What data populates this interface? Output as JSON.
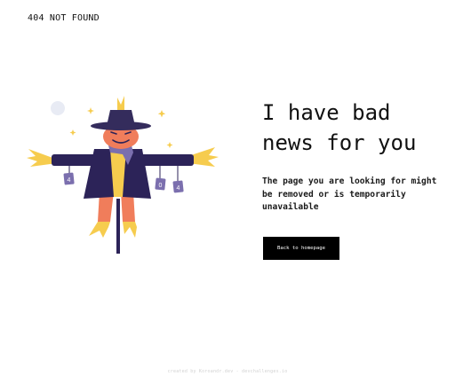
{
  "brand": "404 NOT FOUND",
  "heading": "I have bad news for you",
  "description": "The page you are looking for might be removed or is temporarily unavailable",
  "button": {
    "label": "Back to homepage"
  },
  "footer": {
    "text": "created by Koroandr.dev - devchallenges.io"
  },
  "illustration": {
    "signs": [
      "4",
      "0",
      "4"
    ],
    "colors": {
      "hat": "#342c5c",
      "face": "#f07d5b",
      "coat": "#2c2358",
      "straw": "#f6cc4e",
      "sign": "#7b6fae",
      "moon": "#e8ebf4"
    }
  }
}
